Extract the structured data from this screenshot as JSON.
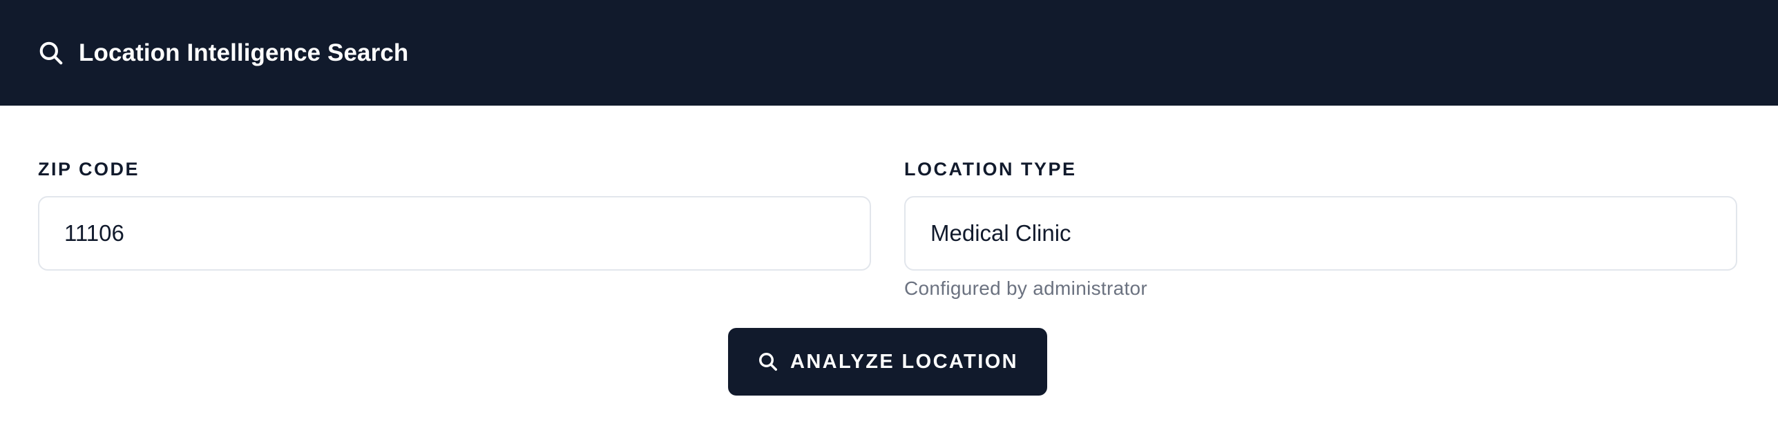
{
  "header": {
    "icon": "search-icon",
    "title": "Location Intelligence Search"
  },
  "form": {
    "zip_code": {
      "label": "ZIP CODE",
      "value": "11106"
    },
    "location_type": {
      "label": "LOCATION TYPE",
      "value": "Medical Clinic",
      "helper": "Configured by administrator"
    }
  },
  "actions": {
    "analyze": {
      "icon": "search-icon",
      "label": "ANALYZE LOCATION"
    }
  },
  "colors": {
    "navy": "#111a2c",
    "border": "#e2e6ec",
    "muted_text": "#6b7280",
    "background": "#ffffff"
  }
}
